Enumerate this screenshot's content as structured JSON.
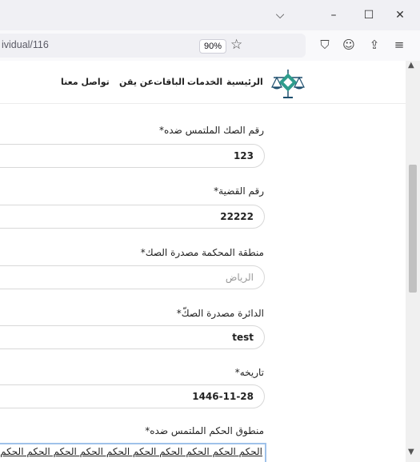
{
  "browser": {
    "url_text": "ividual/116",
    "zoom": "90%",
    "chevron": "⌵",
    "minimize": "–",
    "maximize": "☐",
    "close": "✕",
    "pocket_icon": "⛉",
    "account_icon": "☺",
    "extensions_icon": "⇪",
    "menu_icon": "≡",
    "star_icon": "☆"
  },
  "site": {
    "nav": [
      "الرئيسية",
      "الخدمات",
      "الباقات",
      "عن يقن",
      "تواصل معنا"
    ],
    "colors": {
      "logo": "#2e9c8c",
      "logo_dark": "#1e4f6e"
    }
  },
  "form": {
    "fields": [
      {
        "label": "رقم الصك الملتمس ضده*",
        "value": "123",
        "placeholder": ""
      },
      {
        "label": "رقم القضية*",
        "value": "22222",
        "placeholder": ""
      },
      {
        "label": "منطقة المحكمة مصدرة الصك*",
        "value": "",
        "placeholder": "الرياض"
      },
      {
        "label": "الدائرة مصدرة الصكّ*",
        "value": "test",
        "placeholder": ""
      },
      {
        "label": "تاريخه*",
        "value": "1446-11-28",
        "placeholder": ""
      }
    ],
    "textarea_label": "منطوق الحكم الملتمس ضده*",
    "textarea_value": "الحكم الحكم الحكم الحكم الحكم الحكم الحكم الحكم الحكم الحكم"
  },
  "scroll": {
    "up": "▲",
    "down": "▼"
  }
}
